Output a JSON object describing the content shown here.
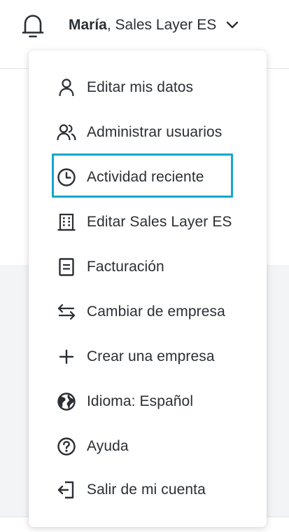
{
  "header": {
    "user_name": "María",
    "company_suffix": ", Sales Layer ES"
  },
  "icons": {
    "notifications": "bell-icon",
    "account_menu": "chevron-down-icon"
  },
  "colors": {
    "highlight": "#16a6cc",
    "text": "#2b2f33"
  },
  "menu": {
    "items": [
      {
        "label": "Editar mis datos",
        "icon": "user-icon"
      },
      {
        "label": "Administrar usuarios",
        "icon": "users-icon"
      },
      {
        "label": "Actividad reciente",
        "icon": "clock-icon",
        "highlighted": true
      },
      {
        "label": "Editar Sales Layer ES",
        "icon": "building-icon"
      },
      {
        "label": "Facturación",
        "icon": "invoice-icon"
      },
      {
        "label": "Cambiar de empresa",
        "icon": "switch-arrows-icon"
      },
      {
        "label": "Crear una empresa",
        "icon": "plus-icon"
      },
      {
        "label": "Idioma: Español",
        "icon": "globe-icon"
      },
      {
        "label": "Ayuda",
        "icon": "help-icon"
      },
      {
        "label": "Salir de mi cuenta",
        "icon": "logout-icon"
      }
    ]
  }
}
